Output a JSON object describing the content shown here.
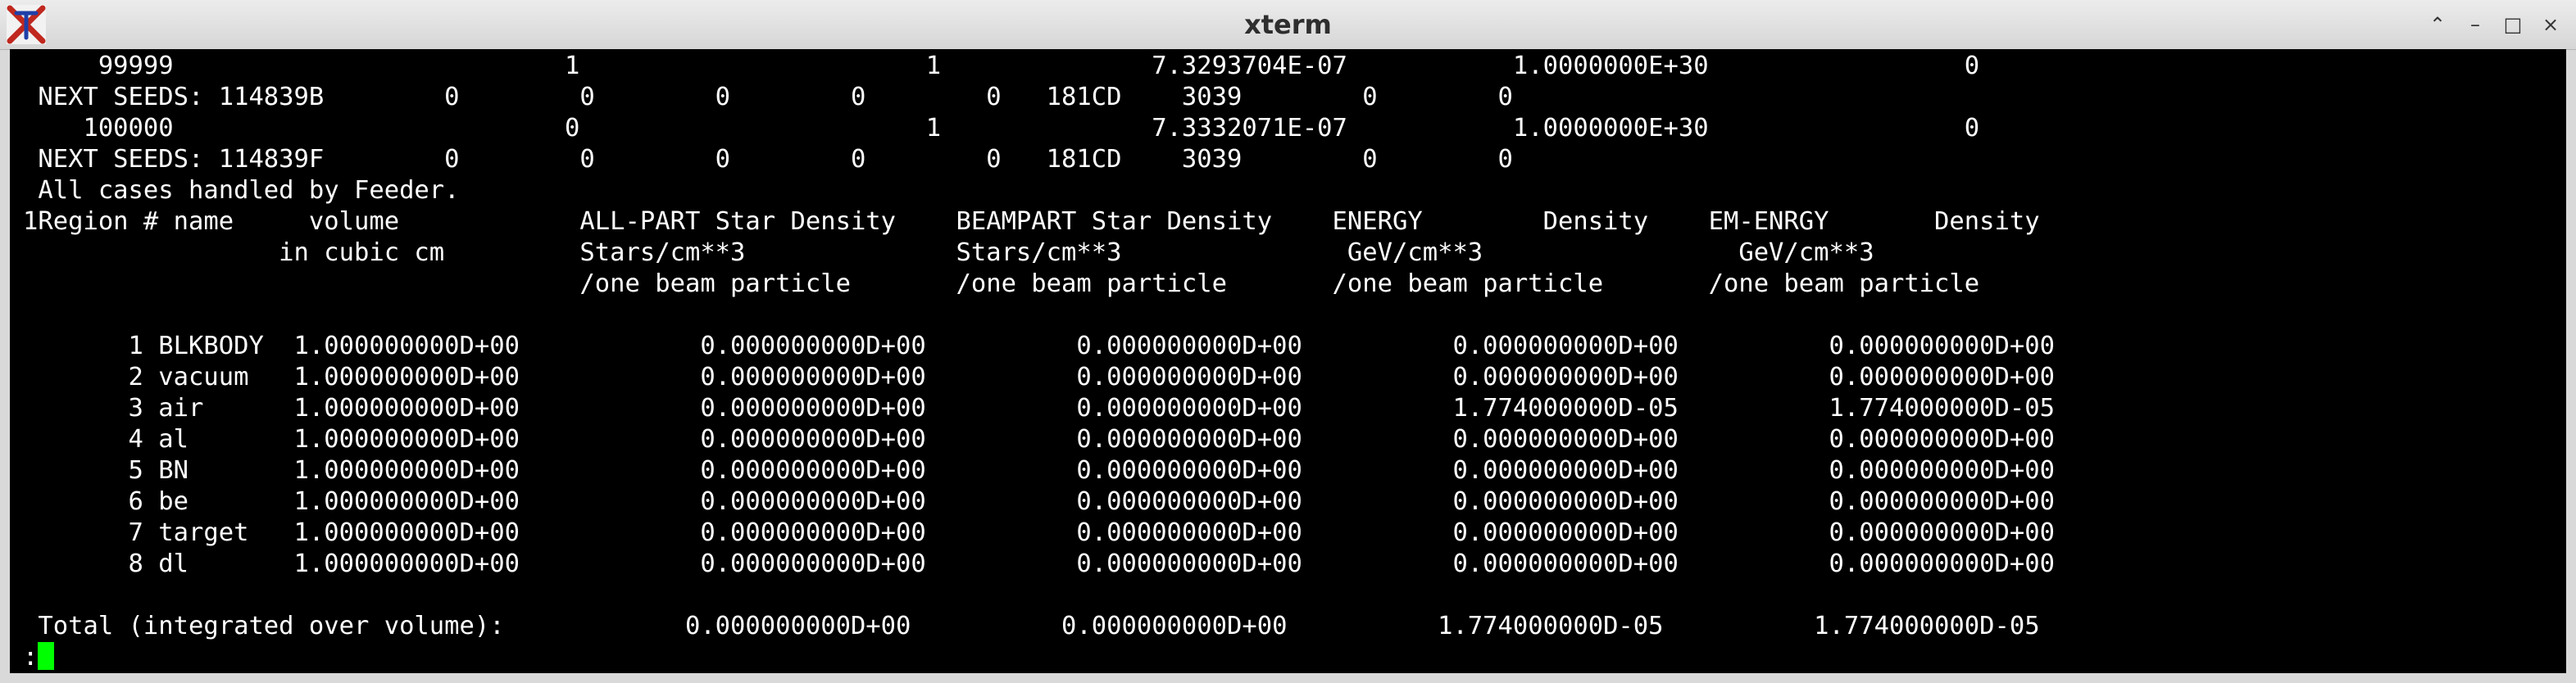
{
  "window": {
    "title": "xterm",
    "controls": [
      "⌃",
      "–",
      "□",
      "×"
    ]
  },
  "terminal": {
    "lines": [
      "     99999                          1                       1              7.3293704E-07           1.0000000E+30                 0",
      " NEXT SEEDS: 114839B        0        0        0        0        0   181CD    3039        0        0",
      "    100000                          0                       1              7.3332071E-07           1.0000000E+30                 0",
      " NEXT SEEDS: 114839F        0        0        0        0        0   181CD    3039        0        0",
      " All cases handled by Feeder.",
      "1Region # name     volume            ALL-PART Star Density    BEAMPART Star Density    ENERGY        Density    EM-ENRGY       Density",
      "                 in cubic cm         Stars/cm**3              Stars/cm**3               GeV/cm**3                 GeV/cm**3",
      "                                     /one beam particle       /one beam particle       /one beam particle       /one beam particle",
      "",
      "       1 BLKBODY  1.000000000D+00            0.000000000D+00          0.000000000D+00          0.000000000D+00          0.000000000D+00",
      "       2 vacuum   1.000000000D+00            0.000000000D+00          0.000000000D+00          0.000000000D+00          0.000000000D+00",
      "       3 air      1.000000000D+00            0.000000000D+00          0.000000000D+00          1.774000000D-05          1.774000000D-05",
      "       4 al       1.000000000D+00            0.000000000D+00          0.000000000D+00          0.000000000D+00          0.000000000D+00",
      "       5 BN       1.000000000D+00            0.000000000D+00          0.000000000D+00          0.000000000D+00          0.000000000D+00",
      "       6 be       1.000000000D+00            0.000000000D+00          0.000000000D+00          0.000000000D+00          0.000000000D+00",
      "       7 target   1.000000000D+00            0.000000000D+00          0.000000000D+00          0.000000000D+00          0.000000000D+00",
      "       8 dl       1.000000000D+00            0.000000000D+00          0.000000000D+00          0.000000000D+00          0.000000000D+00",
      "",
      " Total (integrated over volume):            0.000000000D+00          0.000000000D+00          1.774000000D-05          1.774000000D-05"
    ],
    "prompt": ":"
  },
  "colors": {
    "terminal_bg": "#000000",
    "terminal_fg": "#ffffff",
    "cursor": "#00ff00",
    "titlebar": "#e4e4e4"
  }
}
